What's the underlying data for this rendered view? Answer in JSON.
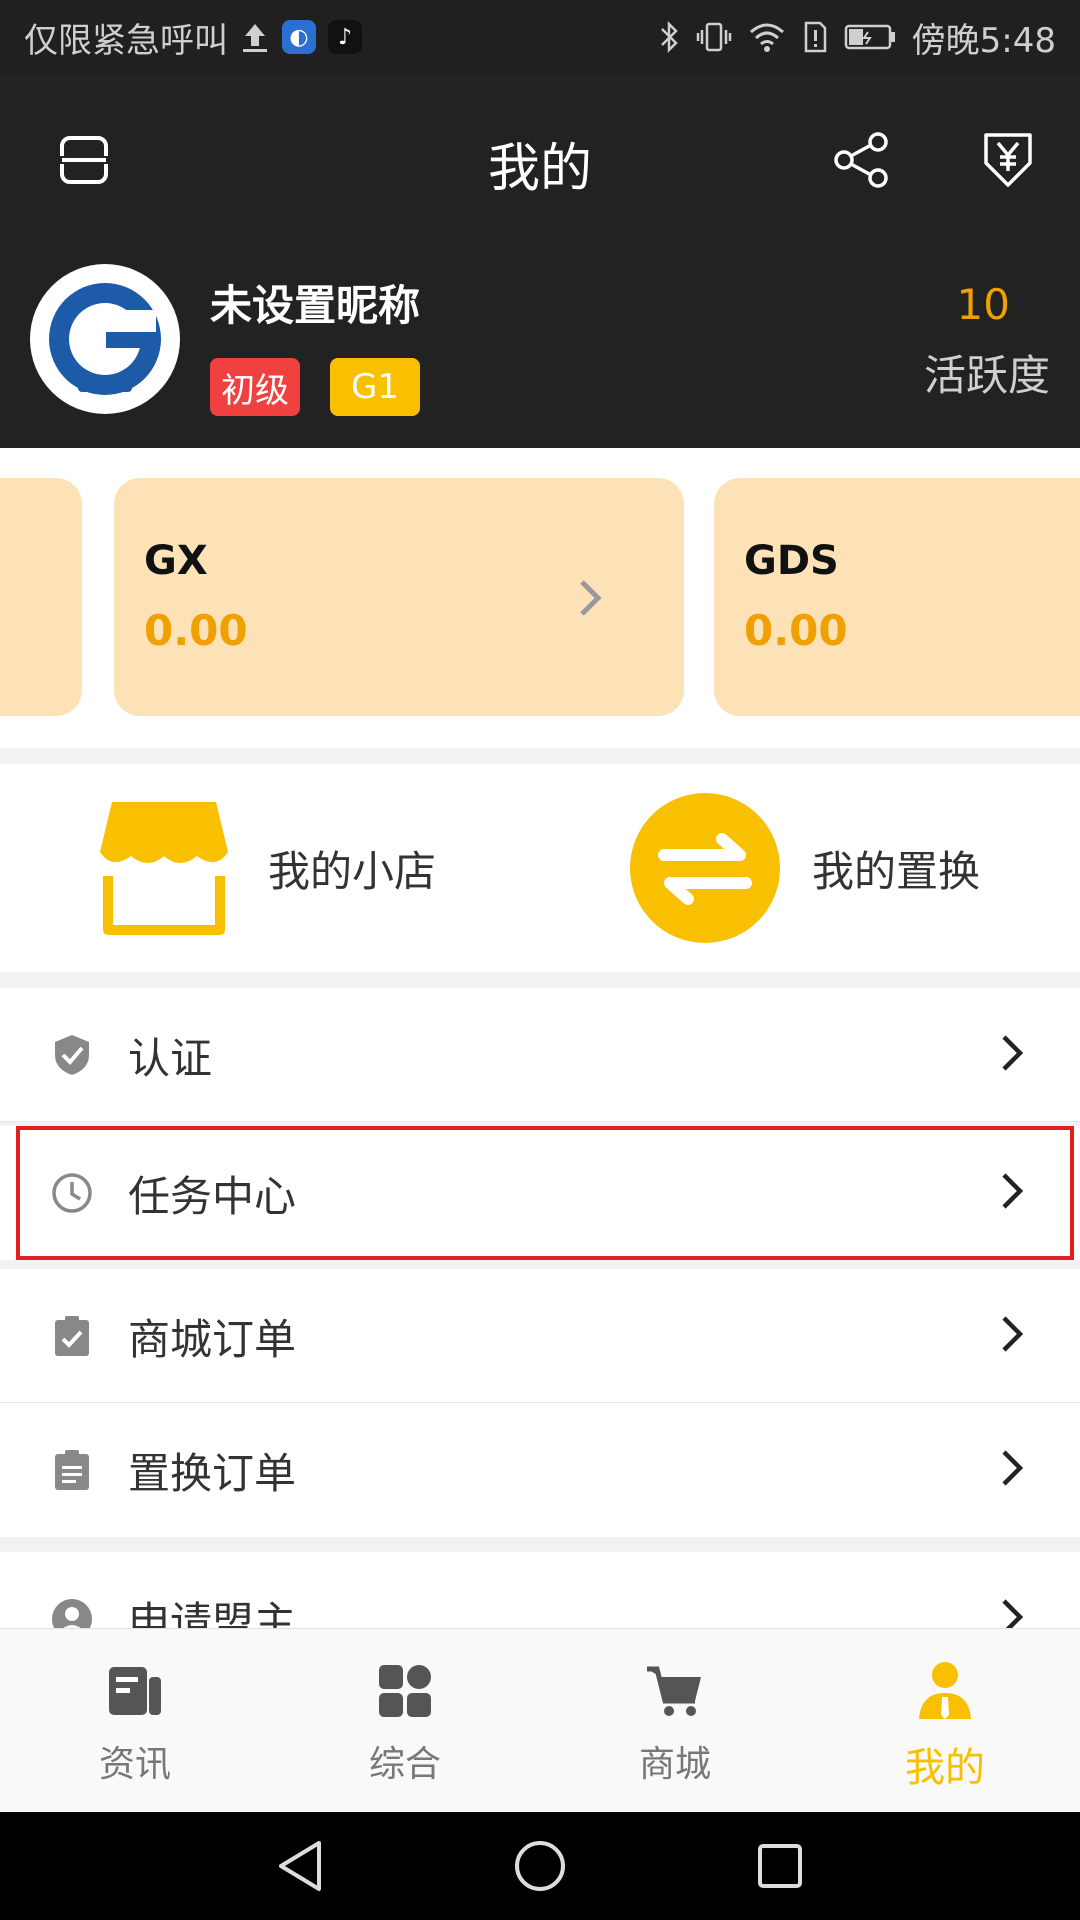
{
  "status_bar": {
    "left_text": "仅限紧急呼叫",
    "time": "傍晚5:48"
  },
  "header": {
    "title": "我的",
    "profile": {
      "nickname": "未设置昵称",
      "level_badge": "初级",
      "grade_badge": "G1",
      "activity_value": "10",
      "activity_label": "活跃度"
    }
  },
  "balances": [
    {
      "name": "GX",
      "value": "0.00"
    },
    {
      "name": "GDS",
      "value": "0.00"
    }
  ],
  "quick_actions": {
    "shop_label": "我的小店",
    "exchange_label": "我的置换"
  },
  "menu": {
    "items": [
      {
        "label": "认证",
        "icon": "shield-check-icon"
      },
      {
        "label": "任务中心",
        "icon": "clock-icon"
      },
      {
        "label": "商城订单",
        "icon": "clipboard-check-icon"
      },
      {
        "label": "置换订单",
        "icon": "clipboard-list-icon"
      },
      {
        "label": "申请盟主",
        "icon": "person-circle-icon"
      }
    ]
  },
  "tabs": [
    {
      "label": "资讯",
      "icon": "news-icon"
    },
    {
      "label": "综合",
      "icon": "grid-icon"
    },
    {
      "label": "商城",
      "icon": "cart-icon"
    },
    {
      "label": "我的",
      "icon": "user-icon",
      "active": true
    }
  ],
  "colors": {
    "accent": "#f8c000",
    "orange_text": "#f0a000",
    "card_bg": "#fde2b8",
    "header_bg": "#222222",
    "highlight": "#e41e1e"
  }
}
